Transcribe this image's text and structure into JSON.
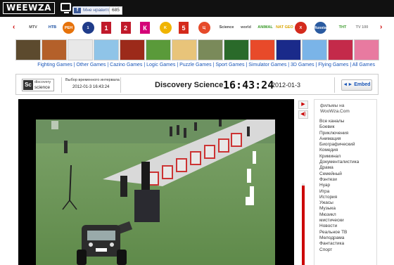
{
  "header": {
    "logo_text": "WEEWZA",
    "fb_like_label": "Мне нравится",
    "fb_like_count": "685"
  },
  "channels": [
    {
      "name": "mtv-logo",
      "label": "MTV",
      "color": "#555"
    },
    {
      "name": "ntv-logo",
      "label": "НТВ",
      "color": "#1a4fa0"
    },
    {
      "name": "ren-logo",
      "label": "РЕН",
      "color": "#e6720a"
    },
    {
      "name": "perviy-logo",
      "label": "1",
      "color": "#1f3c8a"
    },
    {
      "name": "ch1-logo",
      "label": "1",
      "color": "#c01a2b"
    },
    {
      "name": "ch2-logo",
      "label": "2",
      "color": "#c01a2b"
    },
    {
      "name": "kultura-logo",
      "label": "К",
      "color": "#d40078"
    },
    {
      "name": "karusel-logo",
      "label": "K",
      "color": "#f0b400"
    },
    {
      "name": "ch5-logo",
      "label": "5",
      "color": "#d42a1c"
    },
    {
      "name": "tsentr-logo",
      "label": "Ц",
      "color": "#e64a2a"
    },
    {
      "name": "discovery-science-logo",
      "label": "Science",
      "color": "#444"
    },
    {
      "name": "world-logo",
      "label": "world",
      "color": "#555"
    },
    {
      "name": "green-logo",
      "label": "ANIMAL",
      "color": "#3a9a2a"
    },
    {
      "name": "natgeo-logo",
      "label": "NAT GEO",
      "color": "#d9a400"
    },
    {
      "name": "x-logo",
      "label": "X",
      "color": "#d42a1c"
    },
    {
      "name": "globe-logo",
      "label": "Russia",
      "color": "#2a5aa0"
    },
    {
      "name": "tnt-logo",
      "label": "ТНТ",
      "color": "#3a9a2a"
    },
    {
      "name": "tv1000-logo",
      "label": "TV 100",
      "color": "#888"
    }
  ],
  "games": {
    "thumb_colors": [
      "#5c4a2e",
      "#b4602a",
      "#e8e8e8",
      "#8fc4e8",
      "#9c2a1a",
      "#5a9a3a",
      "#e8c47a",
      "#7a8a5a",
      "#2a6a2a",
      "#e84a2a",
      "#1a2a8a",
      "#7ab4e8",
      "#c42a4a",
      "#e87aa0"
    ],
    "categories_text": "Fighting Games | Other Games | Cazino Games | Logic Games | Puzzle Games | Sport Games | Simulator Games | 3D Games | Flying Games | All Games"
  },
  "info": {
    "sc_mark": "Sc",
    "sc_brand_top": "discovery",
    "sc_brand_bottom": "science",
    "interval_label": "Выбор временного интервала",
    "interval_value": "2012-01-3 16:43:24",
    "channel_name": "Discovery Science",
    "clock": "16:43:24",
    "date": "2012-01-3",
    "embed_label": "Embed"
  },
  "controls": {
    "play_icon": "play-icon",
    "mute_icon": "speaker-icon",
    "volume_level": 0.97
  },
  "sidebar": {
    "title": "фильмы на WooWza.Com",
    "items": [
      "Все каналы",
      "Боевик",
      "Приключения",
      "Анимация",
      "Биографический",
      "Комедия",
      "Криминал",
      "Документалистика",
      "Драма",
      "Семейный",
      "Фэнтези",
      "Нуар",
      "Игра",
      "История",
      "Ужасы",
      "Музыка",
      "Мюзикл",
      "мистически",
      "Новости",
      "Реальное ТВ",
      "Мелодрама",
      "Фантастика",
      "Спорт"
    ]
  }
}
